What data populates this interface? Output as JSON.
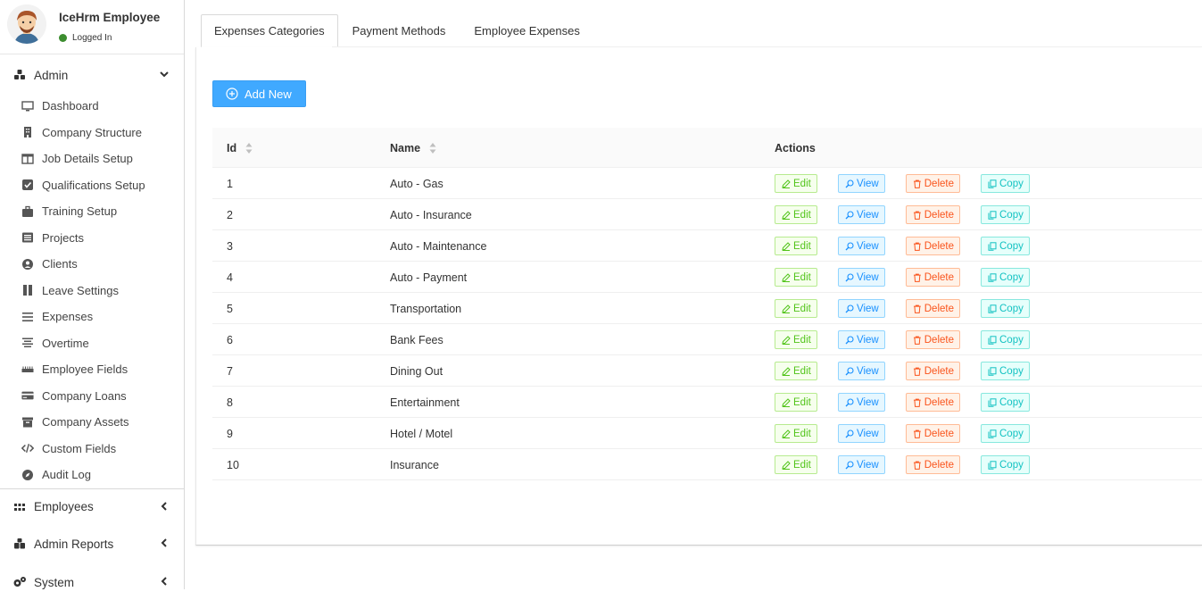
{
  "user": {
    "name": "IceHrm Employee",
    "status": "Logged In"
  },
  "menu": {
    "admin_label": "Admin",
    "admin_items": [
      {
        "label": "Dashboard"
      },
      {
        "label": "Company Structure"
      },
      {
        "label": "Job Details Setup"
      },
      {
        "label": "Qualifications Setup"
      },
      {
        "label": "Training Setup"
      },
      {
        "label": "Projects"
      },
      {
        "label": "Clients"
      },
      {
        "label": "Leave Settings"
      },
      {
        "label": "Expenses"
      },
      {
        "label": "Overtime"
      },
      {
        "label": "Employee Fields"
      },
      {
        "label": "Company Loans"
      },
      {
        "label": "Company Assets"
      },
      {
        "label": "Custom Fields"
      },
      {
        "label": "Audit Log"
      }
    ],
    "employees_label": "Employees",
    "admin_reports_label": "Admin Reports",
    "system_label": "System"
  },
  "tabs": [
    "Expenses Categories",
    "Payment Methods",
    "Employee Expenses"
  ],
  "add_new_label": "Add New",
  "table": {
    "headers": {
      "id": "Id",
      "name": "Name",
      "actions": "Actions"
    },
    "rows": [
      {
        "id": "1",
        "name": "Auto - Gas"
      },
      {
        "id": "2",
        "name": "Auto - Insurance"
      },
      {
        "id": "3",
        "name": "Auto - Maintenance"
      },
      {
        "id": "4",
        "name": "Auto - Payment"
      },
      {
        "id": "5",
        "name": "Transportation"
      },
      {
        "id": "6",
        "name": "Bank Fees"
      },
      {
        "id": "7",
        "name": "Dining Out"
      },
      {
        "id": "8",
        "name": "Entertainment"
      },
      {
        "id": "9",
        "name": "Hotel / Motel"
      },
      {
        "id": "10",
        "name": "Insurance"
      }
    ],
    "actions": {
      "edit": "Edit",
      "view": "View",
      "delete": "Delete",
      "copy": "Copy"
    }
  },
  "colors": {
    "primary": "#40a9ff",
    "edit": "#52c41a",
    "view": "#1890ff",
    "delete": "#fa541c",
    "copy": "#13c2c2",
    "status": "#3c8d2f"
  }
}
